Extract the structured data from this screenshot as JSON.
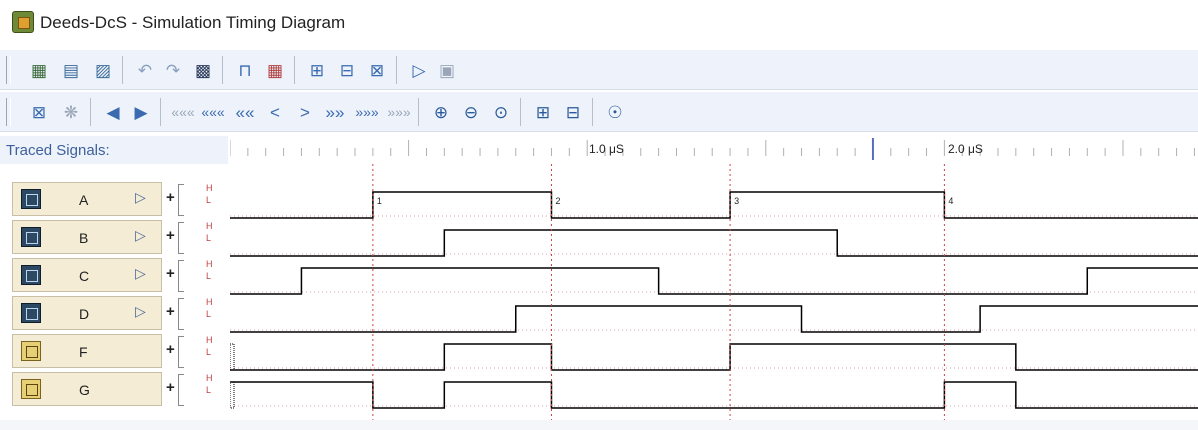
{
  "window": {
    "title": "Deeds-DcS  -  Simulation Timing Diagram",
    "app_icon": "chip-icon"
  },
  "toolbar1": {
    "icons": [
      "print-icon",
      "document-icon",
      "clear-icon",
      "undo-icon",
      "redo-icon",
      "save-icon",
      "step-icon",
      "wave-edit-icon",
      "timing-icon",
      "signal-icon",
      "probe-icon",
      "run-icon",
      "stop-icon"
    ]
  },
  "toolbar2": {
    "icons": [
      "probe-icon",
      "settings-icon",
      "back-icon",
      "forward-icon",
      "goto-start-icon",
      "fast-rewind-icon",
      "rewind-icon",
      "step-back-icon",
      "step-forward-icon",
      "fast-forward-icon",
      "fastest-forward-icon",
      "goto-end-icon",
      "zoom-in-icon",
      "zoom-out-icon",
      "zoom-fit-icon",
      "add-signal-icon",
      "remove-signal-icon",
      "options-icon"
    ],
    "labels": {
      "goto_start": "«««",
      "fast_rewind": "«««",
      "rewind": "««",
      "step_back": "<",
      "step_forward": ">",
      "fast_forward": "»»",
      "fastest_forward": "»»»",
      "goto_end": "»»»"
    }
  },
  "traced": {
    "label": "Traced Signals:"
  },
  "ruler": {
    "labels": [
      "1.0 μS",
      "2.0 μS"
    ],
    "cursor_time_us": 1.8
  },
  "levels": {
    "high": "H",
    "low": "L"
  },
  "timing": {
    "t_start_us": 0,
    "t_end_us": 2.71,
    "markers": [
      {
        "t": 0.4,
        "label": "1"
      },
      {
        "t": 0.9,
        "label": "2"
      },
      {
        "t": 1.4,
        "label": "3"
      },
      {
        "t": 2.0,
        "label": "4"
      }
    ]
  },
  "signals": [
    {
      "name": "A",
      "type": "input",
      "initial": 0,
      "edges": [
        0.4,
        0.9,
        1.4,
        2.0
      ]
    },
    {
      "name": "B",
      "type": "input",
      "initial": 0,
      "edges": [
        0.6,
        1.7
      ]
    },
    {
      "name": "C",
      "type": "input",
      "initial": 0,
      "edges": [
        0.2,
        1.2,
        2.4
      ]
    },
    {
      "name": "D",
      "type": "input",
      "initial": 0,
      "edges": [
        0.8,
        1.6,
        2.1
      ]
    },
    {
      "name": "F",
      "type": "output",
      "initial": 0,
      "edges": [
        0.6,
        0.9,
        1.4,
        2.2
      ]
    },
    {
      "name": "G",
      "type": "output",
      "initial": 1,
      "edges": [
        0.4,
        0.6,
        0.9,
        2.0,
        2.2
      ]
    }
  ],
  "colors": {
    "waveform": "#000000",
    "marker": "#d04040",
    "grid_dot": "#d4a0a0",
    "ruler_tick": "#b0b0b0",
    "cursor": "#5a6cc0"
  }
}
